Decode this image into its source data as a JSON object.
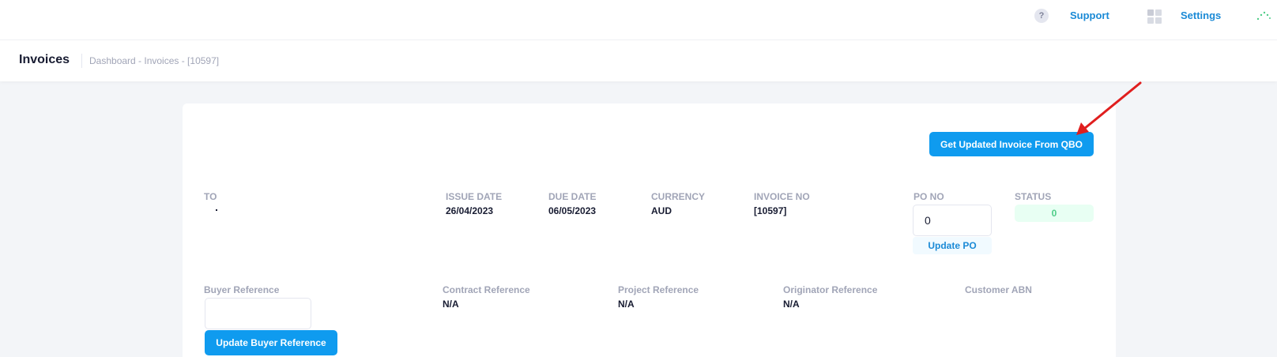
{
  "topbar": {
    "help_icon_glyph": "?",
    "support_label": "Support",
    "settings_label": "Settings"
  },
  "subheader": {
    "title": "Invoices",
    "breadcrumb": "Dashboard - Invoices - [10597]"
  },
  "invoice": {
    "qbo_button_label": "Get Updated Invoice From QBO",
    "to_label": "TO",
    "issue_date_label": "ISSUE DATE",
    "issue_date": "26/04/2023",
    "due_date_label": "DUE DATE",
    "due_date": "06/05/2023",
    "currency_label": "CURRENCY",
    "currency": "AUD",
    "invoice_no_label": "INVOICE NO",
    "invoice_no": "[10597]",
    "po_no_label": "PO NO",
    "po_no_value": "0",
    "update_po_label": "Update PO",
    "status_label": "STATUS",
    "status_value": "0",
    "buyer_reference_label": "Buyer Reference",
    "buyer_reference_value": "",
    "update_buyer_reference_label": "Update Buyer Reference",
    "contract_reference_label": "Contract Reference",
    "contract_reference": "N/A",
    "project_reference_label": "Project Reference",
    "project_reference": "N/A",
    "originator_reference_label": "Originator Reference",
    "originator_reference": "N/A",
    "customer_abn_label": "Customer ABN"
  },
  "colors": {
    "primary": "#0f9bef",
    "link": "#1b8ad6",
    "status_success": "#50cd89",
    "annotation_arrow": "#e01e1e"
  },
  "icons": {
    "help": "question-circle-icon",
    "apps": "grid-icon",
    "loading": "spinner-icon",
    "annotation": "red-arrow-annotation"
  }
}
